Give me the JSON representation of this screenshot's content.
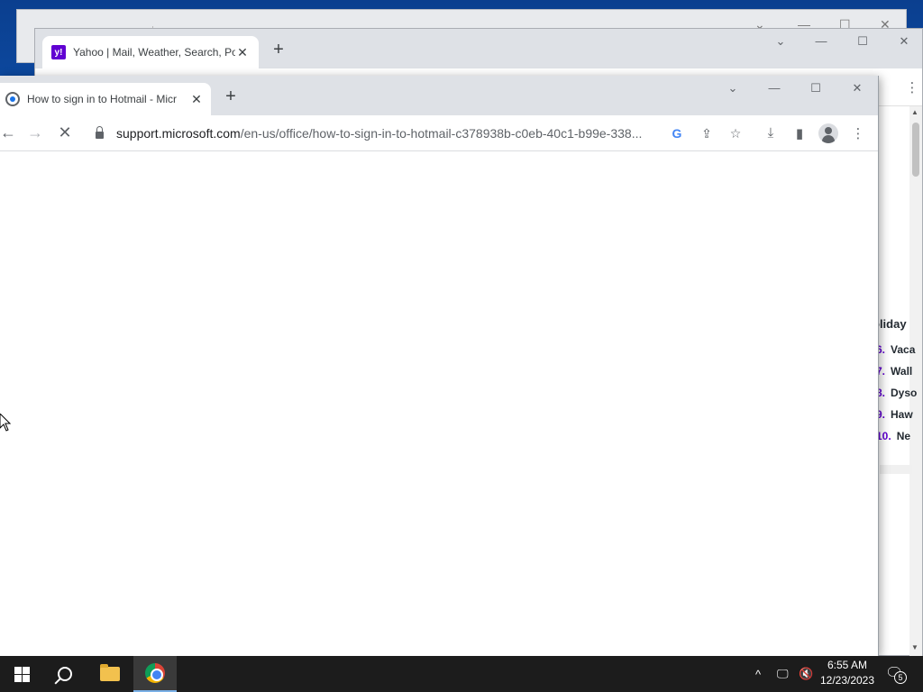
{
  "yahoo_window": {
    "tab_title": "Yahoo | Mail, Weather, Search, Po",
    "favicon_text": "y!",
    "trending_heading": "oliday",
    "trending": [
      {
        "num": "6.",
        "text": "Vaca"
      },
      {
        "num": "7.",
        "text": "Wall"
      },
      {
        "num": "8.",
        "text": "Dyso"
      },
      {
        "num": "9.",
        "text": "Haw"
      },
      {
        "num": "10.",
        "text": "Ne"
      }
    ]
  },
  "main_window": {
    "tab_title": "How to sign in to Hotmail - Micr",
    "url_host": "support.microsoft.com",
    "url_path": "/en-us/office/how-to-sign-in-to-hotmail-c378938b-c0eb-40c1-b99e-338..."
  },
  "icons": {
    "close": "✕",
    "new_tab": "+",
    "chevron": "⌄",
    "minimize": "—",
    "maximize": "☐",
    "back": "←",
    "forward": "→",
    "stop": "✕",
    "google": "G",
    "share": "⇪",
    "star": "☆",
    "download": "⤓",
    "side_panel": "▮",
    "menu": "⋮",
    "tray_up": "^",
    "network": "🖵",
    "volume": "🔇",
    "notification": "🗨"
  },
  "taskbar": {
    "time": "6:55 AM",
    "date": "12/23/2023",
    "notification_count": "5"
  },
  "colors": {
    "taskbar": "#1c1c1c",
    "chrome_tabbar": "#dee1e6",
    "yahoo_brand": "#6001d2"
  }
}
